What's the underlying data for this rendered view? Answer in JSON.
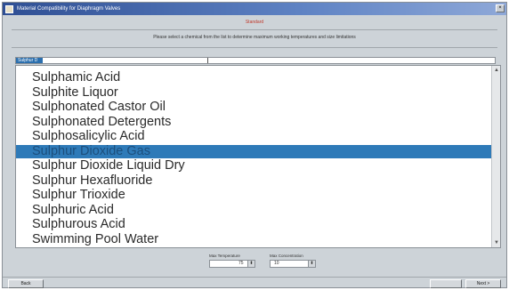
{
  "window": {
    "title": "Material Compatibility for Diaphragm Valves"
  },
  "status_text": "Standard",
  "instruction": "Please select a chemical from the list to determine maximum working temperatures and size limitations",
  "filter": {
    "value": "Sulphur D"
  },
  "list": {
    "items": [
      "Sulphamic Acid",
      "Sulphite Liquor",
      "Sulphonated Castor Oil",
      "Sulphonated Detergents",
      "Sulphosalicylic Acid",
      "Sulphur Dioxide Gas",
      "Sulphur Dioxide Liquid Dry",
      "Sulphur Hexafluoride",
      "Sulphur Trioxide",
      "Sulphuric Acid",
      "Sulphurous Acid",
      "Swimming Pool Water"
    ],
    "selected_index": 5
  },
  "controls": {
    "temperature_label": "Max Temperature",
    "temperature_value": "75",
    "concentration_label": "Max Concentration",
    "concentration_value": "10"
  },
  "buttons": {
    "back": "Back",
    "next": "Next >"
  },
  "colors": {
    "selection": "#2e7ab8",
    "titlebar": "#2f4f94",
    "window_bg": "#cdd3d8"
  }
}
